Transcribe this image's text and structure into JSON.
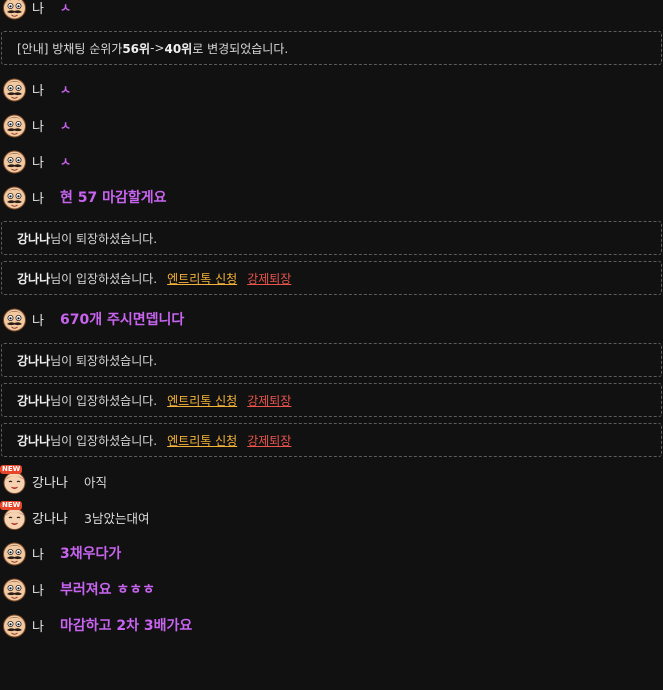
{
  "colors": {
    "background": "#111112",
    "mine_text": "#c864f0",
    "entry_link": "#f5b23a",
    "kick_link": "#e9544c",
    "dashed_border": "#5c5c5c"
  },
  "icons": {
    "my_avatar": "mustache-face-avatar-icon",
    "other_avatar": "new-user-face-avatar-icon"
  },
  "badge_new": "NEW",
  "messages": [
    {
      "kind": "mine",
      "nick": "나",
      "text": "ㅅ",
      "small": true
    },
    {
      "kind": "notice",
      "prefix": "[안내] 방채팅 순위가 ",
      "from": "56위",
      "arrow": " -> ",
      "to": "40위",
      "suffix": " 로 변경되었습니다."
    },
    {
      "kind": "mine",
      "nick": "나",
      "text": "ㅅ",
      "small": true
    },
    {
      "kind": "mine",
      "nick": "나",
      "text": "ㅅ",
      "small": true
    },
    {
      "kind": "mine",
      "nick": "나",
      "text": "ㅅ",
      "small": true
    },
    {
      "kind": "mine",
      "nick": "나",
      "text": "현 57 마감할게요",
      "small": false
    },
    {
      "kind": "leave",
      "user": "강나나",
      "text": "님이 퇴장하셨습니다."
    },
    {
      "kind": "enter",
      "user": "강나나",
      "text": "님이 입장하셨습니다.",
      "entry": "엔트리톡 신청",
      "kick": "강제퇴장"
    },
    {
      "kind": "mine",
      "nick": "나",
      "text": "670개 주시면뎁니다",
      "small": false
    },
    {
      "kind": "leave",
      "user": "강나나",
      "text": "님이 퇴장하셨습니다."
    },
    {
      "kind": "enter",
      "user": "강나나",
      "text": "님이 입장하셨습니다.",
      "entry": "엔트리톡 신청",
      "kick": "강제퇴장"
    },
    {
      "kind": "enter",
      "user": "강나나",
      "text": "님이 입장하셨습니다.",
      "entry": "엔트리톡 신청",
      "kick": "강제퇴장"
    },
    {
      "kind": "other",
      "nick": "강나나",
      "text": "아직"
    },
    {
      "kind": "other",
      "nick": "강나나",
      "text": "3남았는대여"
    },
    {
      "kind": "mine",
      "nick": "나",
      "text": "3채우다가",
      "small": false
    },
    {
      "kind": "mine",
      "nick": "나",
      "text": "부러져요 ㅎㅎㅎ",
      "small": false
    },
    {
      "kind": "mine",
      "nick": "나",
      "text": "마감하고 2차 3배가요",
      "small": false
    }
  ]
}
